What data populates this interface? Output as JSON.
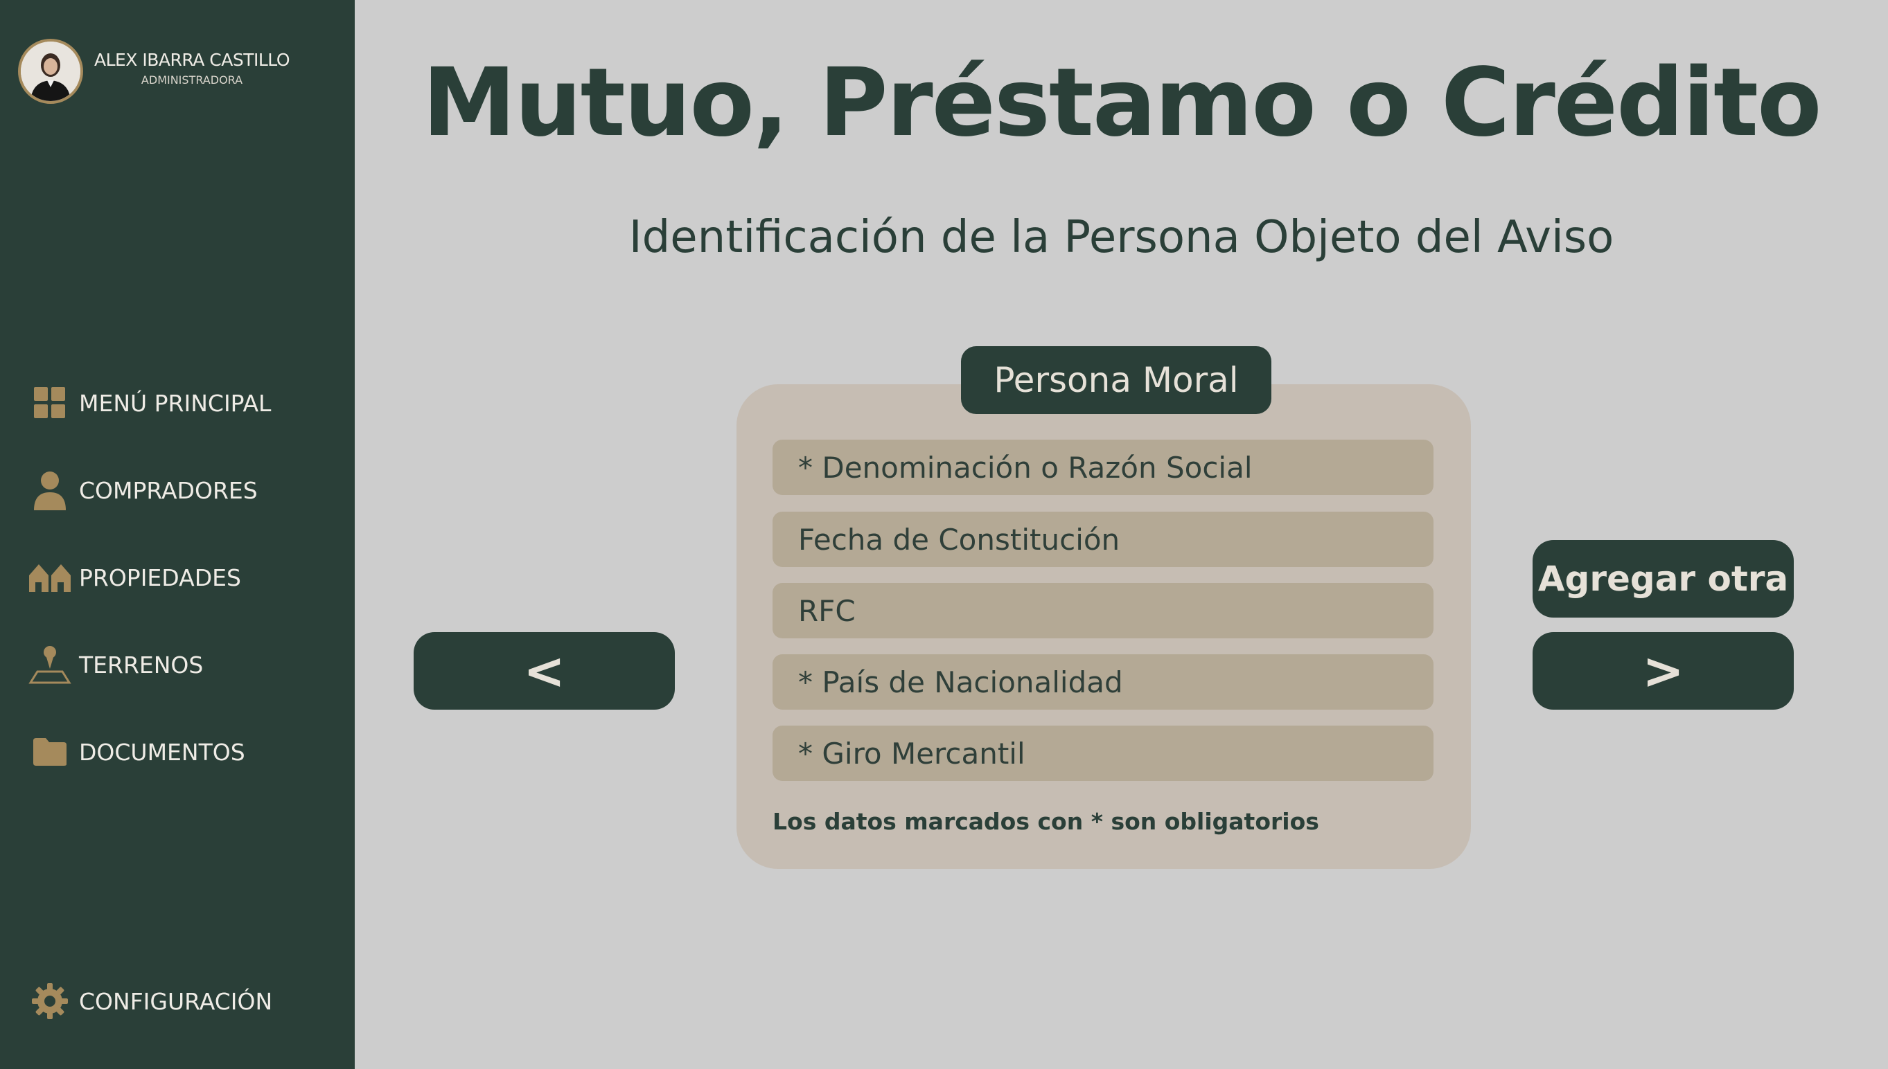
{
  "user": {
    "name": "ALEX IBARRA CASTILLO",
    "role": "ADMINISTRADORA"
  },
  "sidebar": {
    "items": [
      {
        "label": "MENÚ PRINCIPAL",
        "icon": "grid-icon"
      },
      {
        "label": "COMPRADORES",
        "icon": "person-icon"
      },
      {
        "label": "PROPIEDADES",
        "icon": "houses-icon"
      },
      {
        "label": "TERRENOS",
        "icon": "land-pin-icon"
      },
      {
        "label": "DOCUMENTOS",
        "icon": "folder-icon"
      }
    ],
    "settings": {
      "label": "CONFIGURACIÓN",
      "icon": "gear-icon"
    }
  },
  "page": {
    "title": "Mutuo, Préstamo o Crédito",
    "subtitle": "Identificación de la Persona Objeto del Aviso"
  },
  "form": {
    "tab_label": "Persona Moral",
    "fields": [
      {
        "placeholder": "* Denominación o Razón Social"
      },
      {
        "placeholder": "Fecha de Constitución"
      },
      {
        "placeholder": "RFC"
      },
      {
        "placeholder": "* País  de Nacionalidad"
      },
      {
        "placeholder": "* Giro Mercantil"
      }
    ],
    "note": "Los datos marcados con * son obligatorios"
  },
  "buttons": {
    "prev": "<",
    "next": ">",
    "add": "Agregar otra"
  },
  "colors": {
    "sidebar_bg": "#2a3f38",
    "accent_gold": "#a58a5c",
    "page_bg": "#cdcdcd",
    "card_bg": "#c6bdb3",
    "field_bg": "#b4a995"
  }
}
